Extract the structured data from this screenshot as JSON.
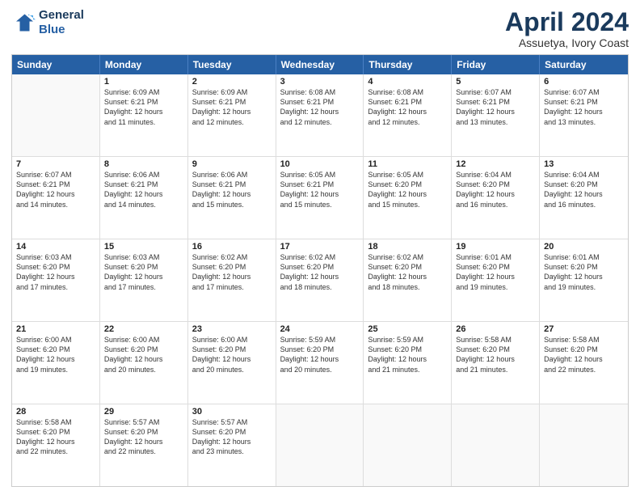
{
  "logo": {
    "line1": "General",
    "line2": "Blue"
  },
  "title": "April 2024",
  "subtitle": "Assuetya, Ivory Coast",
  "headers": [
    "Sunday",
    "Monday",
    "Tuesday",
    "Wednesday",
    "Thursday",
    "Friday",
    "Saturday"
  ],
  "weeks": [
    [
      {
        "day": "",
        "info": ""
      },
      {
        "day": "1",
        "info": "Sunrise: 6:09 AM\nSunset: 6:21 PM\nDaylight: 12 hours\nand 11 minutes."
      },
      {
        "day": "2",
        "info": "Sunrise: 6:09 AM\nSunset: 6:21 PM\nDaylight: 12 hours\nand 12 minutes."
      },
      {
        "day": "3",
        "info": "Sunrise: 6:08 AM\nSunset: 6:21 PM\nDaylight: 12 hours\nand 12 minutes."
      },
      {
        "day": "4",
        "info": "Sunrise: 6:08 AM\nSunset: 6:21 PM\nDaylight: 12 hours\nand 12 minutes."
      },
      {
        "day": "5",
        "info": "Sunrise: 6:07 AM\nSunset: 6:21 PM\nDaylight: 12 hours\nand 13 minutes."
      },
      {
        "day": "6",
        "info": "Sunrise: 6:07 AM\nSunset: 6:21 PM\nDaylight: 12 hours\nand 13 minutes."
      }
    ],
    [
      {
        "day": "7",
        "info": "Sunrise: 6:07 AM\nSunset: 6:21 PM\nDaylight: 12 hours\nand 14 minutes."
      },
      {
        "day": "8",
        "info": "Sunrise: 6:06 AM\nSunset: 6:21 PM\nDaylight: 12 hours\nand 14 minutes."
      },
      {
        "day": "9",
        "info": "Sunrise: 6:06 AM\nSunset: 6:21 PM\nDaylight: 12 hours\nand 15 minutes."
      },
      {
        "day": "10",
        "info": "Sunrise: 6:05 AM\nSunset: 6:21 PM\nDaylight: 12 hours\nand 15 minutes."
      },
      {
        "day": "11",
        "info": "Sunrise: 6:05 AM\nSunset: 6:20 PM\nDaylight: 12 hours\nand 15 minutes."
      },
      {
        "day": "12",
        "info": "Sunrise: 6:04 AM\nSunset: 6:20 PM\nDaylight: 12 hours\nand 16 minutes."
      },
      {
        "day": "13",
        "info": "Sunrise: 6:04 AM\nSunset: 6:20 PM\nDaylight: 12 hours\nand 16 minutes."
      }
    ],
    [
      {
        "day": "14",
        "info": "Sunrise: 6:03 AM\nSunset: 6:20 PM\nDaylight: 12 hours\nand 17 minutes."
      },
      {
        "day": "15",
        "info": "Sunrise: 6:03 AM\nSunset: 6:20 PM\nDaylight: 12 hours\nand 17 minutes."
      },
      {
        "day": "16",
        "info": "Sunrise: 6:02 AM\nSunset: 6:20 PM\nDaylight: 12 hours\nand 17 minutes."
      },
      {
        "day": "17",
        "info": "Sunrise: 6:02 AM\nSunset: 6:20 PM\nDaylight: 12 hours\nand 18 minutes."
      },
      {
        "day": "18",
        "info": "Sunrise: 6:02 AM\nSunset: 6:20 PM\nDaylight: 12 hours\nand 18 minutes."
      },
      {
        "day": "19",
        "info": "Sunrise: 6:01 AM\nSunset: 6:20 PM\nDaylight: 12 hours\nand 19 minutes."
      },
      {
        "day": "20",
        "info": "Sunrise: 6:01 AM\nSunset: 6:20 PM\nDaylight: 12 hours\nand 19 minutes."
      }
    ],
    [
      {
        "day": "21",
        "info": "Sunrise: 6:00 AM\nSunset: 6:20 PM\nDaylight: 12 hours\nand 19 minutes."
      },
      {
        "day": "22",
        "info": "Sunrise: 6:00 AM\nSunset: 6:20 PM\nDaylight: 12 hours\nand 20 minutes."
      },
      {
        "day": "23",
        "info": "Sunrise: 6:00 AM\nSunset: 6:20 PM\nDaylight: 12 hours\nand 20 minutes."
      },
      {
        "day": "24",
        "info": "Sunrise: 5:59 AM\nSunset: 6:20 PM\nDaylight: 12 hours\nand 20 minutes."
      },
      {
        "day": "25",
        "info": "Sunrise: 5:59 AM\nSunset: 6:20 PM\nDaylight: 12 hours\nand 21 minutes."
      },
      {
        "day": "26",
        "info": "Sunrise: 5:58 AM\nSunset: 6:20 PM\nDaylight: 12 hours\nand 21 minutes."
      },
      {
        "day": "27",
        "info": "Sunrise: 5:58 AM\nSunset: 6:20 PM\nDaylight: 12 hours\nand 22 minutes."
      }
    ],
    [
      {
        "day": "28",
        "info": "Sunrise: 5:58 AM\nSunset: 6:20 PM\nDaylight: 12 hours\nand 22 minutes."
      },
      {
        "day": "29",
        "info": "Sunrise: 5:57 AM\nSunset: 6:20 PM\nDaylight: 12 hours\nand 22 minutes."
      },
      {
        "day": "30",
        "info": "Sunrise: 5:57 AM\nSunset: 6:20 PM\nDaylight: 12 hours\nand 23 minutes."
      },
      {
        "day": "",
        "info": ""
      },
      {
        "day": "",
        "info": ""
      },
      {
        "day": "",
        "info": ""
      },
      {
        "day": "",
        "info": ""
      }
    ]
  ]
}
